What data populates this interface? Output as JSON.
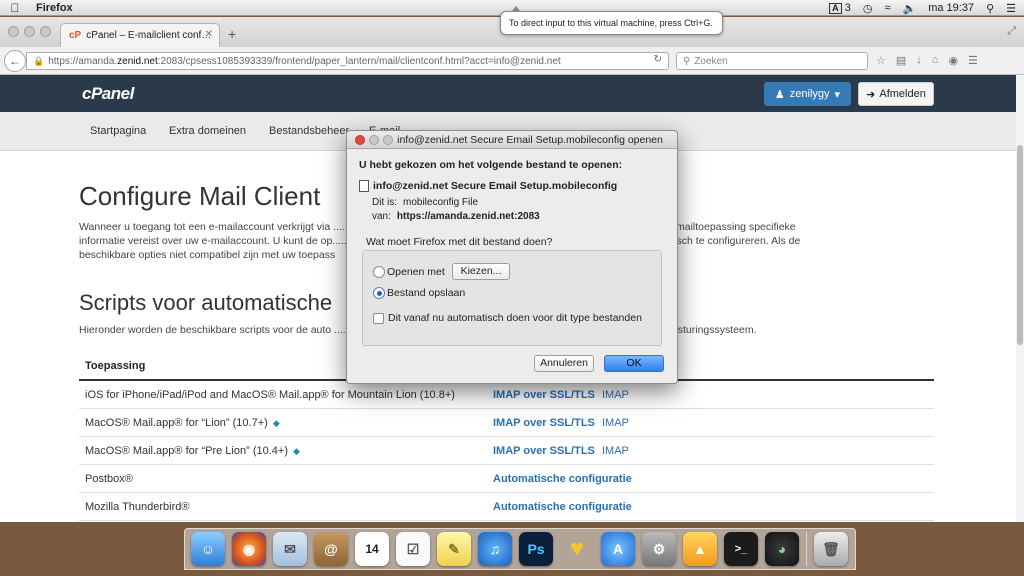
{
  "menubar": {
    "app": "Firefox",
    "badge": "A",
    "count": "3",
    "clock": "ma 19:37"
  },
  "vm_tooltip": "To direct input to this virtual machine, press Ctrl+G.",
  "browser": {
    "tab_title": "cPanel – E-mailclient conf…",
    "url_prefix": "https://amanda.",
    "url_domain": "zenid.net",
    "url_rest": ":2083/cpsess1085393339/frontend/paper_lantern/mail/clientconf.html?acct=info@zenid.net",
    "search_placeholder": "Zoeken"
  },
  "cpanel": {
    "logo": "cPanel",
    "user": "zenilygy",
    "logout": "Afmelden",
    "nav": [
      "Startpagina",
      "Extra domeinen",
      "Bestandsbeheer",
      "E-mail"
    ],
    "title": "Configure Mail Client",
    "intro_lines": [
      "Wanneer u toegang tot een e-mailaccount verkrijgt via ......................................................................................... °/+), is voor de e-mailtoepassing specifieke",
      "informatie vereist over uw e-mailaccount. U kunt de op............................................................................. -mailtoepassing automatisch te configureren. Als de",
      "beschikbare opties niet compatibel zijn met uw toepass"
    ],
    "scripts_title": "Scripts voor automatische",
    "scripts_desc": "Hieronder worden de beschikbare scripts voor de auto ........................................................................... voor uw e-mailclient en besturingssysteem.",
    "table_header": "Toepassing",
    "rows": [
      {
        "app": "iOS for iPhone/iPad/iPod and MacOS® Mail.app® for Mountain Lion (10.8+)",
        "link1": "IMAP over SSL/TLS",
        "link2": "IMAP",
        "tag": false
      },
      {
        "app": "MacOS® Mail.app® for “Lion” (10.7+)",
        "link1": "IMAP over SSL/TLS",
        "link2": "IMAP",
        "tag": true
      },
      {
        "app": "MacOS® Mail.app® for “Pre Lion” (10.4+)",
        "link1": "IMAP over SSL/TLS",
        "link2": "IMAP",
        "tag": true
      },
      {
        "app": "Postbox®",
        "link1": "Automatische configuratie",
        "link2": "",
        "tag": false
      },
      {
        "app": "Mozilla Thunderbird®",
        "link1": "Automatische configuratie",
        "link2": "",
        "tag": false
      }
    ]
  },
  "dialog": {
    "title": "info@zenid.net Secure Email Setup.mobileconfig openen",
    "lead": "U hebt gekozen om het volgende bestand te openen:",
    "filename": "info@zenid.net Secure Email Setup.mobileconfig",
    "type_label": "Dit is:",
    "type_value": "mobileconfig File",
    "from_label": "van:",
    "from_value": "https://amanda.zenid.net:2083",
    "question": "Wat moet Firefox met dit bestand doen?",
    "open_with": "Openen met",
    "choose": "Kiezen...",
    "save": "Bestand opslaan",
    "auto": "Dit vanaf nu automatisch doen voor dit type bestanden",
    "cancel": "Annuleren",
    "ok": "OK",
    "selected": "save"
  },
  "dock": [
    "finder",
    "firefox",
    "mail",
    "contacts",
    "calendar",
    "reminders",
    "notes",
    "itunes",
    "photoshop",
    "cyberduck",
    "app-store",
    "system-preferences",
    "vlc",
    "terminal",
    "dashboard",
    "trash"
  ],
  "dock_calendar_day": "14",
  "dock_ps": "Ps",
  "colors": {
    "cpanel_header": "#2b3a4a",
    "user_button": "#337ab7",
    "link": "#2a6fb5",
    "ok_button": "#2f7ff0"
  }
}
